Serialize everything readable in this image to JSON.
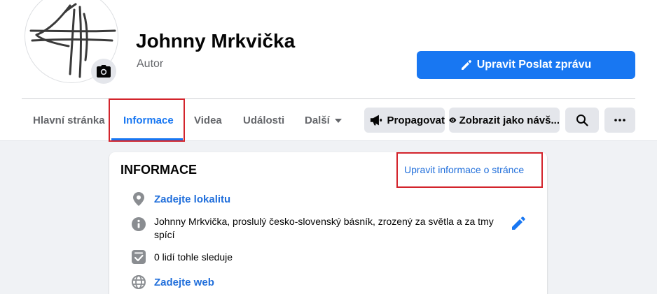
{
  "profile": {
    "name": "Johnny Mrkvička",
    "category": "Autor",
    "primary_button_label": "Upravit Poslat zprávu"
  },
  "tabs": [
    {
      "label": "Hlavní stránka",
      "active": false
    },
    {
      "label": "Informace",
      "active": true
    },
    {
      "label": "Videa",
      "active": false
    },
    {
      "label": "Události",
      "active": false
    },
    {
      "label": "Další",
      "active": false
    }
  ],
  "toolbar": {
    "promote_label": "Propagovat",
    "view_as_label": "Zobrazit jako návš..."
  },
  "about": {
    "title": "INFORMACE",
    "edit_link": "Upravit informace o stránce",
    "location": "Zadejte lokalitu",
    "description": "Johnny Mrkvička, proslulý česko-slovenský básník, zrozený za světla a za tmy spící",
    "followers": "0 lidí tohle sleduje",
    "website": "Zadejte web"
  },
  "icons": {
    "camera": "camera-icon",
    "pencil": "pencil-icon",
    "megaphone": "megaphone-icon",
    "eye": "eye-icon",
    "search": "search-icon",
    "more": "more-icon",
    "location": "location-pin-icon",
    "info": "info-icon",
    "followers": "followers-icon",
    "globe": "globe-icon"
  },
  "colors": {
    "accent": "#1877f2",
    "link": "#216fdb",
    "highlight": "#d3242c",
    "secondary_text": "#65676b",
    "button_gray": "#e4e6eb",
    "page_bg": "#f0f2f5"
  }
}
